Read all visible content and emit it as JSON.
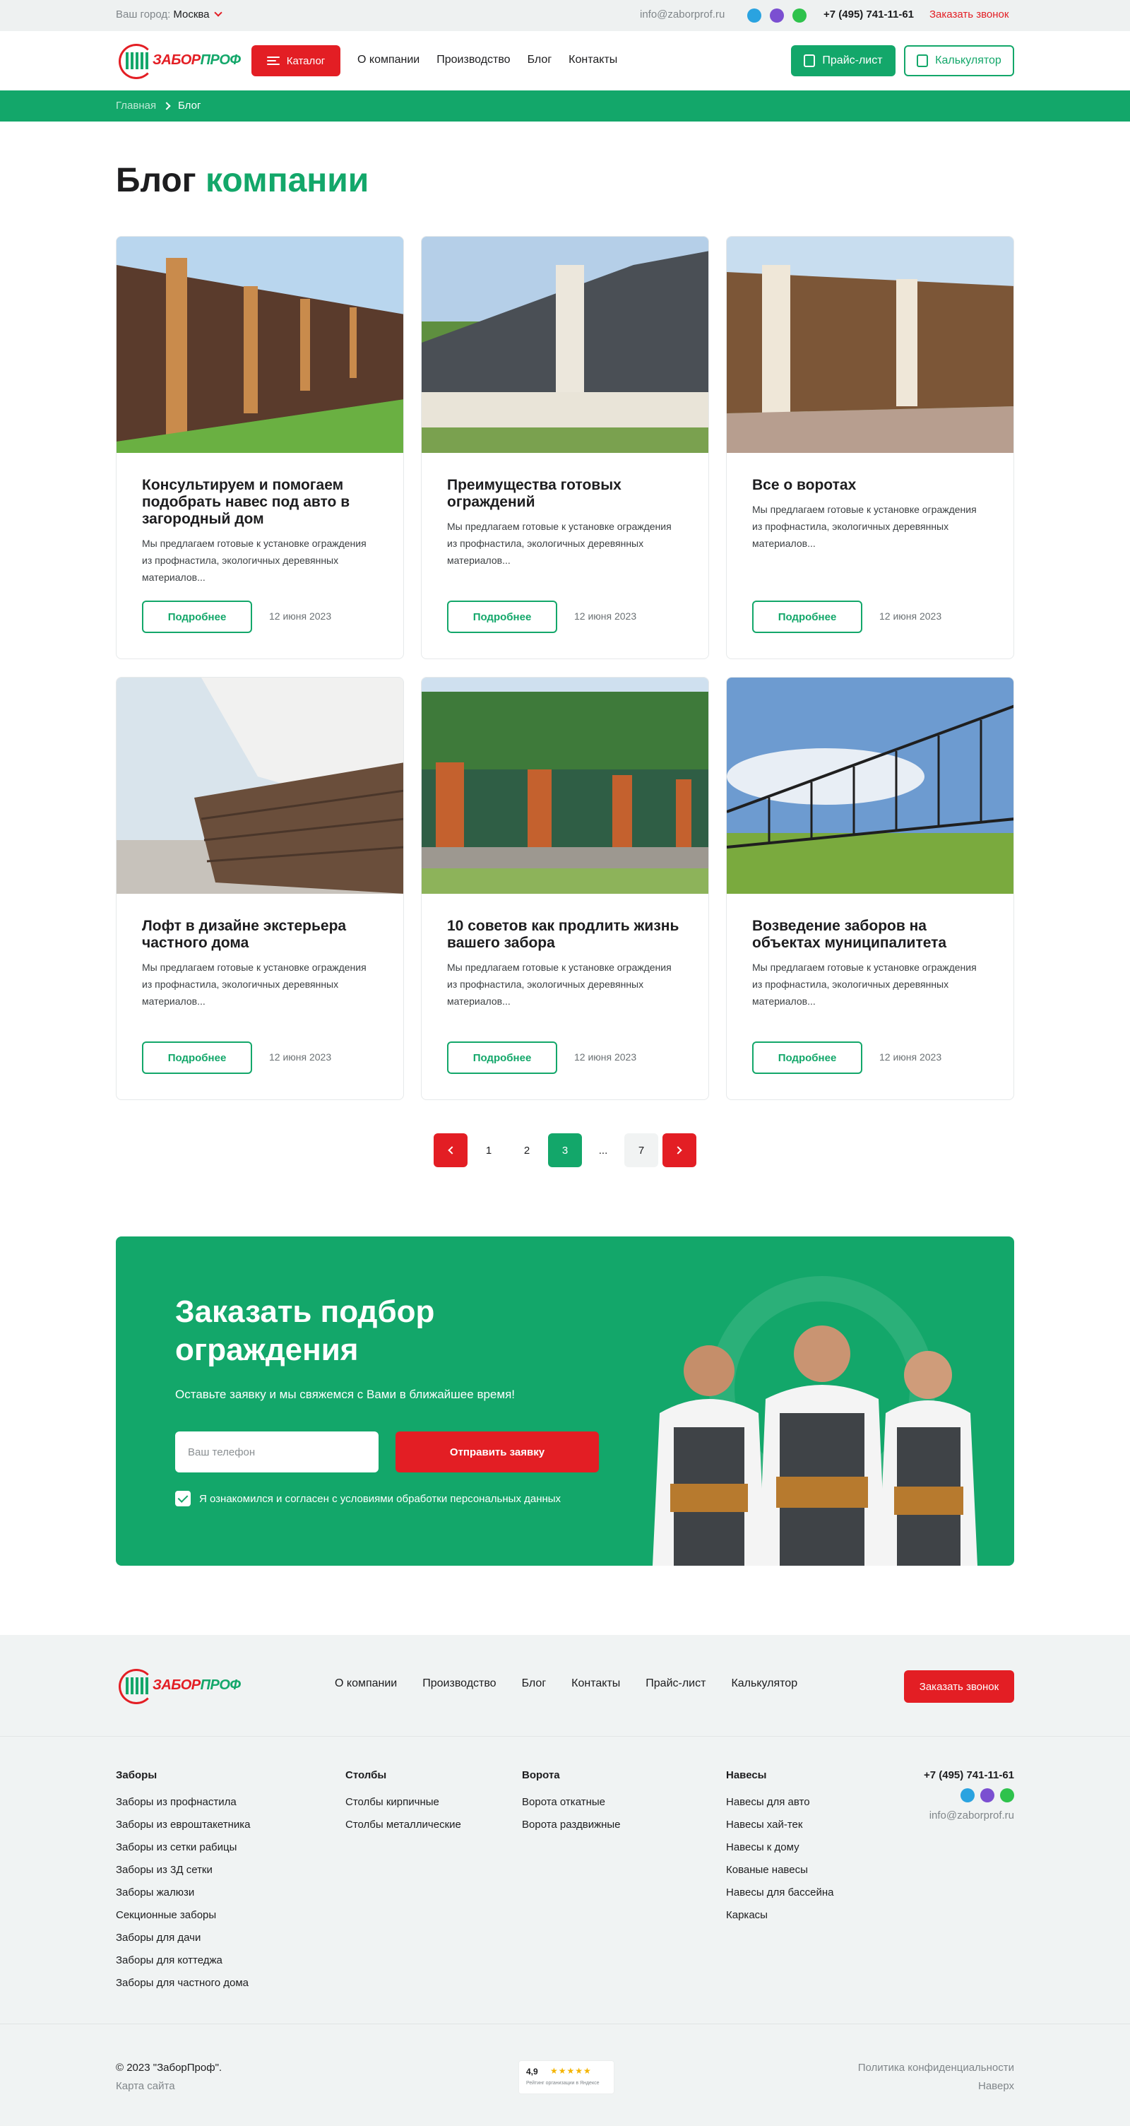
{
  "topbar": {
    "city_label": "Ваш город:",
    "city_value": "Москва",
    "email": "info@zaborprof.ru",
    "phone": "+7 (495) 741-11-61",
    "callback": "Заказать звонок",
    "social": [
      "telegram-icon",
      "viber-icon",
      "whatsapp-icon"
    ]
  },
  "header": {
    "logo_text_1": "ЗАБОР",
    "logo_text_2": "ПРОФ",
    "catalog": "Каталог",
    "nav": [
      "О компании",
      "Производство",
      "Блог",
      "Контакты"
    ],
    "price_list": "Прайс-лист",
    "calculator": "Калькулятор"
  },
  "breadcrumb": {
    "home": "Главная",
    "current": "Блог"
  },
  "page": {
    "title_1": "Блог",
    "title_2": "компании"
  },
  "posts": [
    {
      "title": "Консультируем и помогаем подобрать навес под авто в загородный дом",
      "desc": "Мы предлагаем готовые к установке ограждения из профнастила, экологичных деревянных материалов...",
      "more": "Подробнее",
      "date": "12 июня 2023"
    },
    {
      "title": "Преимущества готовых ограждений",
      "desc": "Мы предлагаем готовые к установке ограждения из профнастила, экологичных деревянных материалов...",
      "more": "Подробнее",
      "date": "12 июня 2023"
    },
    {
      "title": "Все о воротах",
      "desc": "Мы предлагаем готовые к установке ограждения из профнастила, экологичных деревянных материалов...",
      "more": "Подробнее",
      "date": "12 июня 2023"
    },
    {
      "title": "Лофт в дизайне экстерьера частного дома",
      "desc": "Мы предлагаем готовые к установке ограждения из профнастила, экологичных деревянных материалов...",
      "more": "Подробнее",
      "date": "12 июня 2023"
    },
    {
      "title": "10 советов как продлить жизнь вашего забора",
      "desc": "Мы предлагаем готовые к установке ограждения из профнастила, экологичных деревянных материалов...",
      "more": "Подробнее",
      "date": "12 июня 2023"
    },
    {
      "title": "Возведение заборов на объектах муниципалитета",
      "desc": "Мы предлагаем готовые к установке ограждения из профнастила, экологичных деревянных материалов...",
      "more": "Подробнее",
      "date": "12 июня 2023"
    }
  ],
  "pagination": {
    "pages": [
      "1",
      "2",
      "3",
      "...",
      "7"
    ],
    "current": "3"
  },
  "cta": {
    "title": "Заказать подбор ограждения",
    "subtitle": "Оставьте заявку и мы свяжемся с Вами в ближайшее время!",
    "phone_placeholder": "Ваш телефон",
    "submit": "Отправить заявку",
    "agree": "Я ознакомился и согласен с условиями обработки персональных данных"
  },
  "footer": {
    "nav": [
      "О компании",
      "Производство",
      "Блог",
      "Контакты",
      "Прайс-лист",
      "Калькулятор"
    ],
    "callback": "Заказать звонок",
    "columns": [
      {
        "head": "Заборы",
        "items": [
          "Заборы из профнастила",
          "Заборы из евроштакетника",
          "Заборы из сетки рабицы",
          "Заборы из 3Д сетки",
          "Заборы жалюзи",
          "Секционные заборы",
          "Заборы для дачи",
          "Заборы для коттеджа",
          "Заборы для частного дома"
        ]
      },
      {
        "head": "Столбы",
        "items": [
          "Столбы кирпичные",
          "Столбы металлические"
        ]
      },
      {
        "head": "Ворота",
        "items": [
          "Ворота откатные",
          "Ворота раздвижные"
        ]
      },
      {
        "head": "Навесы",
        "items": [
          "Навесы для авто",
          "Навесы хай-тек",
          "Навесы к дому",
          "Кованые навесы",
          "Навесы для бассейна",
          "Каркасы"
        ]
      }
    ],
    "phone": "+7 (495) 741-11-61",
    "email": "info@zaborprof.ru",
    "copyright": "© 2023 \"ЗаборПроф\".",
    "sitemap": "Карта сайта",
    "rating": {
      "value": "4,9",
      "stars": "★★★★★",
      "caption": "Рейтинг организации в Яндексе"
    },
    "policy": "Политика конфиденциальности",
    "up": "Наверх"
  },
  "colors": {
    "green": "#13a76a",
    "red": "#e31e24",
    "footer_bg": "#f0f3f3"
  }
}
